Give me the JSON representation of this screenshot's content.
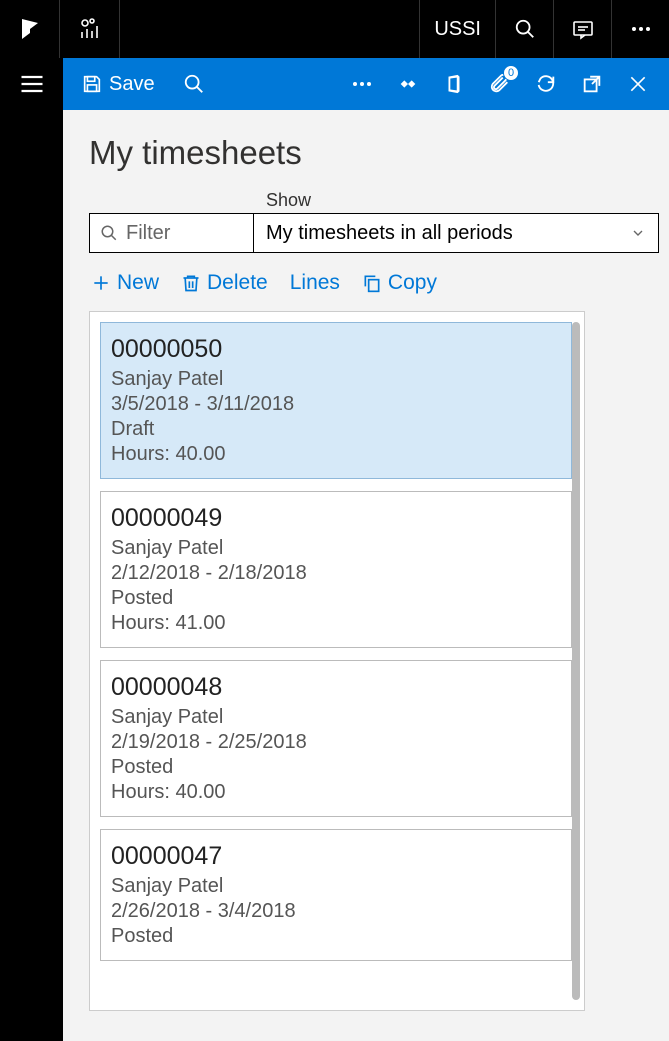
{
  "top": {
    "company": "USSI"
  },
  "actionbar": {
    "save_label": "Save",
    "attachment_badge": "0"
  },
  "page": {
    "title": "My timesheets",
    "show_label": "Show",
    "filter_placeholder": "Filter",
    "show_value": "My timesheets in all periods"
  },
  "toolbar": {
    "new_label": "New",
    "delete_label": "Delete",
    "lines_label": "Lines",
    "copy_label": "Copy"
  },
  "hours_prefix": "Hours: ",
  "timesheets": [
    {
      "id": "00000050",
      "name": "Sanjay Patel",
      "period": "3/5/2018 - 3/11/2018",
      "status": "Draft",
      "hours": "40.00",
      "selected": true
    },
    {
      "id": "00000049",
      "name": "Sanjay Patel",
      "period": "2/12/2018 - 2/18/2018",
      "status": "Posted",
      "hours": "41.00",
      "selected": false
    },
    {
      "id": "00000048",
      "name": "Sanjay Patel",
      "period": "2/19/2018 - 2/25/2018",
      "status": "Posted",
      "hours": "40.00",
      "selected": false
    },
    {
      "id": "00000047",
      "name": "Sanjay Patel",
      "period": "2/26/2018 - 3/4/2018",
      "status": "Posted",
      "hours": "",
      "selected": false
    }
  ]
}
